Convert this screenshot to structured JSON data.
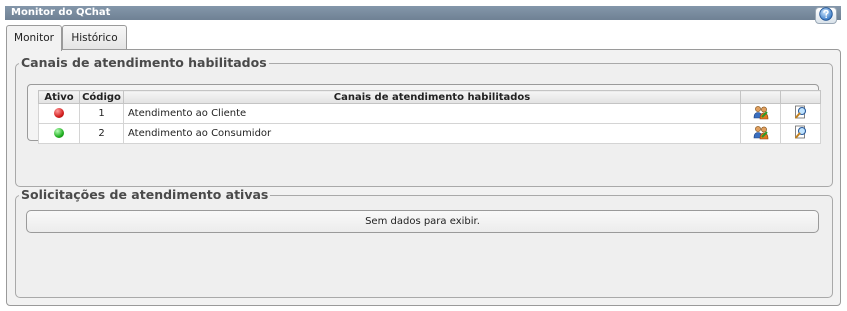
{
  "window": {
    "title": "Monitor do QChat"
  },
  "help": {
    "icon": "help-globe-icon"
  },
  "tabs": [
    {
      "label": "Monitor",
      "active": true
    },
    {
      "label": "Histórico",
      "active": false
    }
  ],
  "channels_section": {
    "legend": "Canais de atendimento habilitados",
    "columns": {
      "active": "Ativo",
      "code": "Código",
      "name": "Canais de atendimento habilitados",
      "action1": "",
      "action2": ""
    },
    "rows": [
      {
        "status": "red",
        "code": "1",
        "name": "Atendimento ao Cliente",
        "action1_icon": "users-icon",
        "action2_icon": "magnifier-icon"
      },
      {
        "status": "green",
        "code": "2",
        "name": "Atendimento ao Consumidor",
        "action1_icon": "users-icon",
        "action2_icon": "magnifier-icon"
      }
    ]
  },
  "requests_section": {
    "legend": "Solicitações de atendimento ativas",
    "empty_message": "Sem dados para exibir."
  },
  "colors": {
    "titlebar": "#7a8c9f",
    "status_red": "#d42020",
    "status_green": "#22b022"
  }
}
